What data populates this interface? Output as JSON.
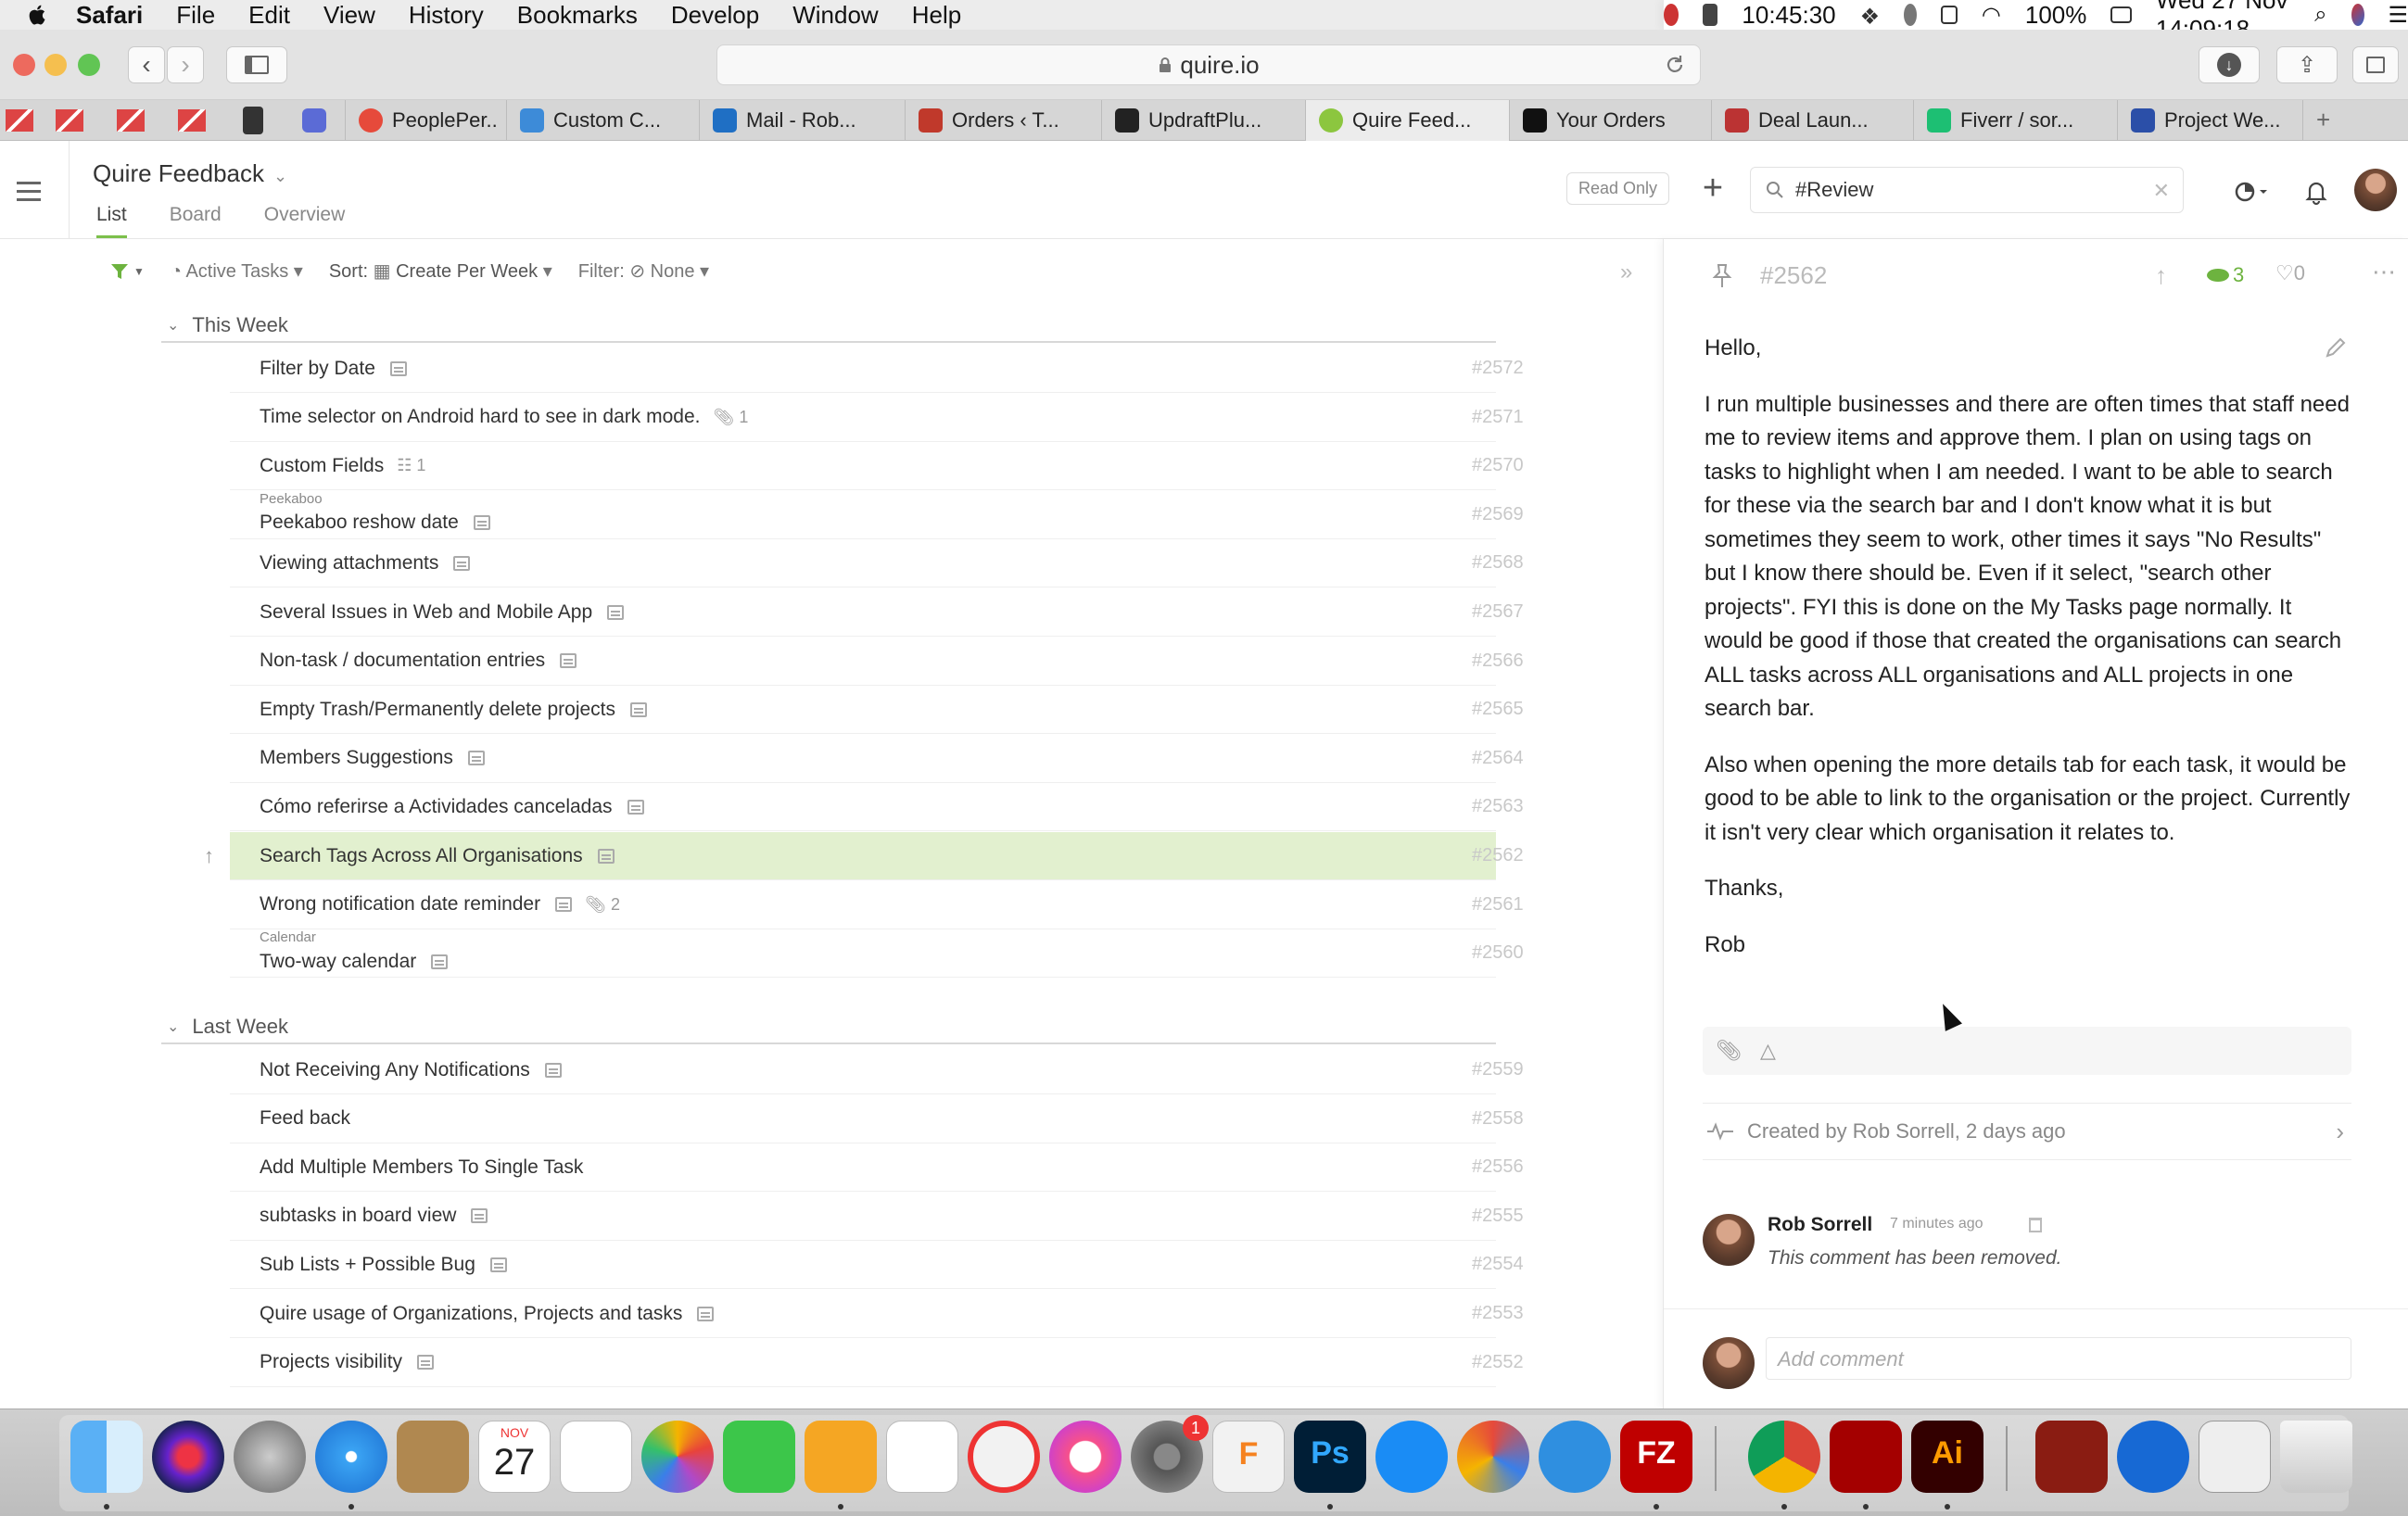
{
  "menubar": {
    "app": "Safari",
    "items": [
      "File",
      "Edit",
      "View",
      "History",
      "Bookmarks",
      "Develop",
      "Window",
      "Help"
    ],
    "time_left": "10:45:30",
    "battery": "100%",
    "datetime": "Wed 27 Nov  14:09:18"
  },
  "browser": {
    "url": "quire.io"
  },
  "tabs": [
    {
      "label": "PeoplePer..",
      "color": "#e64a3b"
    },
    {
      "label": "Custom C...",
      "color": "#3d8bd8"
    },
    {
      "label": "Mail - Rob...",
      "color": "#1f6fc4"
    },
    {
      "label": "Orders ‹ T...",
      "color": "#c0392b"
    },
    {
      "label": "UpdraftPlu...",
      "color": "#222222"
    },
    {
      "label": "Quire Feed...",
      "color": "#8cc63f"
    },
    {
      "label": "Your Orders",
      "color": "#111111"
    },
    {
      "label": "Deal Laun...",
      "color": "#b33"
    },
    {
      "label": "Fiverr / sor...",
      "color": "#1dbf73"
    },
    {
      "label": "Project We...",
      "color": "#2b4fa8"
    }
  ],
  "header": {
    "project": "Quire Feedback",
    "views": [
      "List",
      "Board",
      "Overview"
    ],
    "read_only": "Read Only",
    "search_value": "#Review"
  },
  "filters": {
    "active": "Active Tasks",
    "sort_label": "Sort:",
    "sort_value": "Create Per Week",
    "filter_label": "Filter:",
    "filter_value": "None"
  },
  "sections": {
    "this_week": "This Week",
    "last_week": "Last Week"
  },
  "this_week_tasks": [
    {
      "name": "Filter by Date",
      "id": "#2572",
      "note": true
    },
    {
      "name": "Time selector on Android hard to see in dark mode.",
      "id": "#2571",
      "attach": "1"
    },
    {
      "name": "Custom Fields",
      "id": "#2570",
      "sub": "1"
    },
    {
      "name": "Peekaboo reshow date",
      "id": "#2569",
      "tag": "Peekaboo",
      "note": true
    },
    {
      "name": "Viewing attachments",
      "id": "#2568",
      "note": true
    },
    {
      "name": "Several Issues in Web and Mobile App",
      "id": "#2567",
      "note": true
    },
    {
      "name": "Non-task / documentation entries",
      "id": "#2566",
      "note": true
    },
    {
      "name": "Empty Trash/Permanently delete projects",
      "id": "#2565",
      "note": true
    },
    {
      "name": "Members Suggestions",
      "id": "#2564",
      "note": true
    },
    {
      "name": "Cómo referirse a Actividades canceladas",
      "id": "#2563",
      "note": true
    },
    {
      "name": "Search Tags Across All Organisations",
      "id": "#2562",
      "note": true,
      "selected": true
    },
    {
      "name": "Wrong notification date reminder",
      "id": "#2561",
      "note": true,
      "attach": "2"
    },
    {
      "name": "Two-way calendar",
      "id": "#2560",
      "tag": "Calendar",
      "note": true
    }
  ],
  "last_week_tasks": [
    {
      "name": "Not Receiving Any Notifications",
      "id": "#2559",
      "note": true
    },
    {
      "name": "Feed back",
      "id": "#2558"
    },
    {
      "name": "Add Multiple Members To Single Task",
      "id": "#2556"
    },
    {
      "name": "subtasks in board view",
      "id": "#2555",
      "note": true
    },
    {
      "name": "Sub Lists + Possible Bug",
      "id": "#2554",
      "note": true
    },
    {
      "name": "Quire usage of Organizations, Projects and tasks",
      "id": "#2553",
      "note": true
    },
    {
      "name": "Projects visibility",
      "id": "#2552",
      "note": true
    }
  ],
  "detail": {
    "id": "#2562",
    "views": "3",
    "likes": "0",
    "paragraphs": [
      "Hello,",
      "I run multiple businesses and there are often times that staff need me to review items and approve them. I plan on using tags on tasks to highlight when I am needed. I want to be able to search for these via the search bar and I don't know what it is but sometimes they seem to work, other times it says \"No Results\" but I know there should be. Even if it select, \"search other projects\". FYI this is done on the My Tasks page normally. It would be good if those that created the organisations can search ALL tasks across ALL organisations and ALL projects in one search bar.",
      "Also when opening the more details tab for each task, it would be good to be able to link to the organisation or the project. Currently it isn't very clear which organisation it relates to.",
      "Thanks,",
      "Rob"
    ],
    "created": "Created by Rob Sorrell, 2 days ago",
    "comment_author": "Rob Sorrell",
    "comment_time": "7 minutes ago",
    "comment_text": "This comment has been removed.",
    "add_comment_placeholder": "Add comment"
  },
  "dock": {
    "calendar_month": "NOV",
    "calendar_day": "27",
    "settings_badge": "1",
    "ps": "Ps",
    "ai": "Ai",
    "fz": "FZ"
  }
}
